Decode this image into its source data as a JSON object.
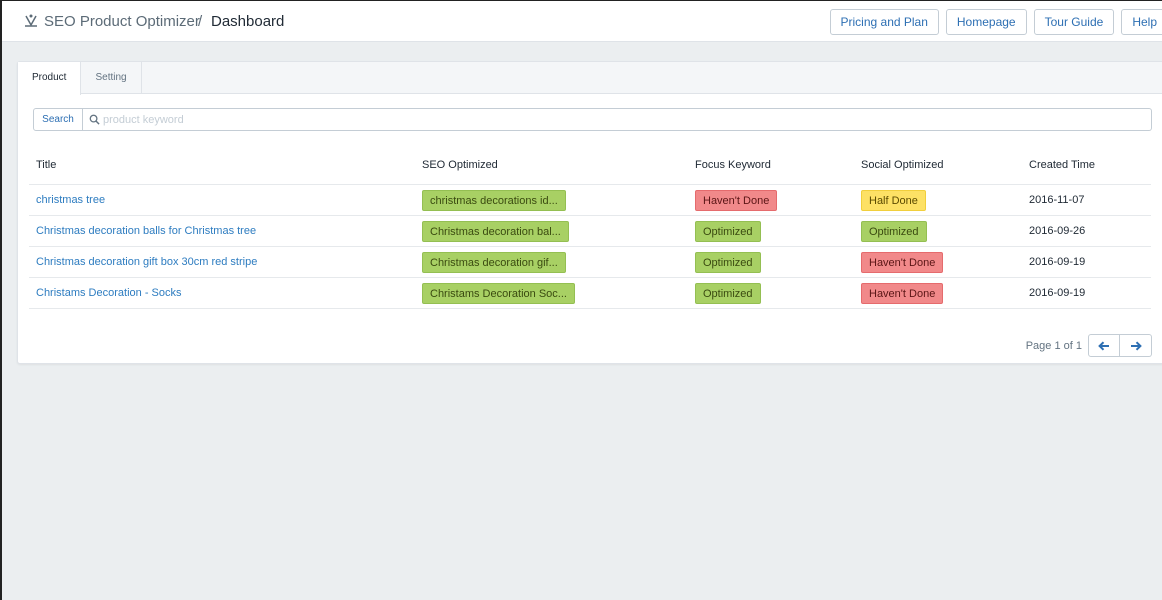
{
  "header": {
    "app_title": "SEO Product Optimizer",
    "separator": "/",
    "page": "Dashboard",
    "buttons": [
      "Pricing and Plan",
      "Homepage",
      "Tour Guide",
      "Help"
    ]
  },
  "tabs": [
    "Product",
    "Setting"
  ],
  "search": {
    "button_label": "Search",
    "placeholder": "product keyword",
    "value": ""
  },
  "table": {
    "columns": [
      "Title",
      "SEO Optimized",
      "Focus Keyword",
      "Social Optimized",
      "Created Time"
    ],
    "rows": [
      {
        "title": "christmas tree",
        "seo": "christmas decorations id...",
        "focus": "Haven't Done",
        "social": "Half Done",
        "created": "2016-11-07"
      },
      {
        "title": "Christmas decoration balls for Christmas tree",
        "seo": "Christmas decoration bal...",
        "focus": "Optimized",
        "social": "Optimized",
        "created": "2016-09-26"
      },
      {
        "title": "Christmas decoration gift box 30cm red stripe",
        "seo": "Christmas decoration gif...",
        "focus": "Optimized",
        "social": "Haven't Done",
        "created": "2016-09-19"
      },
      {
        "title": "Christams Decoration - Socks",
        "seo": "Christams Decoration Soc...",
        "focus": "Optimized",
        "social": "Haven't Done",
        "created": "2016-09-19"
      }
    ]
  },
  "pagination": {
    "text": "Page 1 of 1"
  },
  "colors": {
    "optimized": "#a8d064",
    "havent_done": "#f1898a",
    "half_done": "#fde165",
    "link": "#2d7cc0"
  }
}
